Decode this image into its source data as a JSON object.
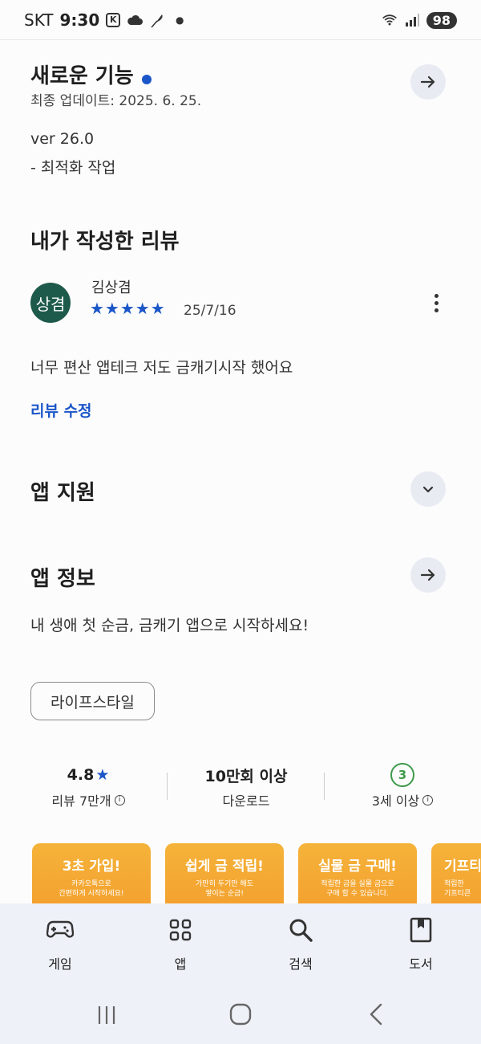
{
  "status": {
    "carrier": "SKT",
    "time": "9:30",
    "battery": "98"
  },
  "whats_new": {
    "title": "새로운 기능",
    "updated": "최종 업데이트: 2025. 6. 25.",
    "version": "ver 26.0",
    "notes": "- 최적화 작업"
  },
  "my_review": {
    "title": "내가 작성한 리뷰",
    "avatar_text": "상겸",
    "author": "김상겸",
    "rating": 5,
    "stars": "★★★★★",
    "date": "25/7/16",
    "text": "너무 편산 앱테크 저도 금캐기시작 했어요",
    "edit_label": "리뷰 수정"
  },
  "app_support": {
    "title": "앱 지원"
  },
  "app_info": {
    "title": "앱 정보",
    "description": "내 생애 첫 순금, 금캐기 앱으로 시작하세요!",
    "category": "라이프스타일"
  },
  "stats": {
    "rating_value": "4.8",
    "rating_star": "★",
    "reviews_label": "리뷰 7만개",
    "downloads_value": "10만회 이상",
    "downloads_label": "다운로드",
    "age_value": "3",
    "age_label": "3세 이상"
  },
  "screenshots": [
    {
      "title": "3초 가입!",
      "desc1": "카카오톡으로",
      "desc2": "간편하게 시작하세요!"
    },
    {
      "title": "쉽게 금 적립!",
      "desc1": "가만히 두기만 해도",
      "desc2": "쌓이는 순금!"
    },
    {
      "title": "실물 금 구매!",
      "desc1": "적립한 금을 실물 금으로",
      "desc2": "구매 할 수 있습니다."
    },
    {
      "title": "기프티",
      "desc1": "적립한",
      "desc2": "기프티콘"
    }
  ],
  "bottom_nav": {
    "items": [
      {
        "label": "게임",
        "icon": "gamepad-icon"
      },
      {
        "label": "앱",
        "icon": "apps-grid-icon"
      },
      {
        "label": "검색",
        "icon": "search-icon"
      },
      {
        "label": "도서",
        "icon": "book-icon"
      }
    ]
  },
  "colors": {
    "accent": "#1a56c8",
    "avatar_bg": "#1e5a4b",
    "age_green": "#3e9a4a",
    "nav_bg": "#eef1f8"
  }
}
